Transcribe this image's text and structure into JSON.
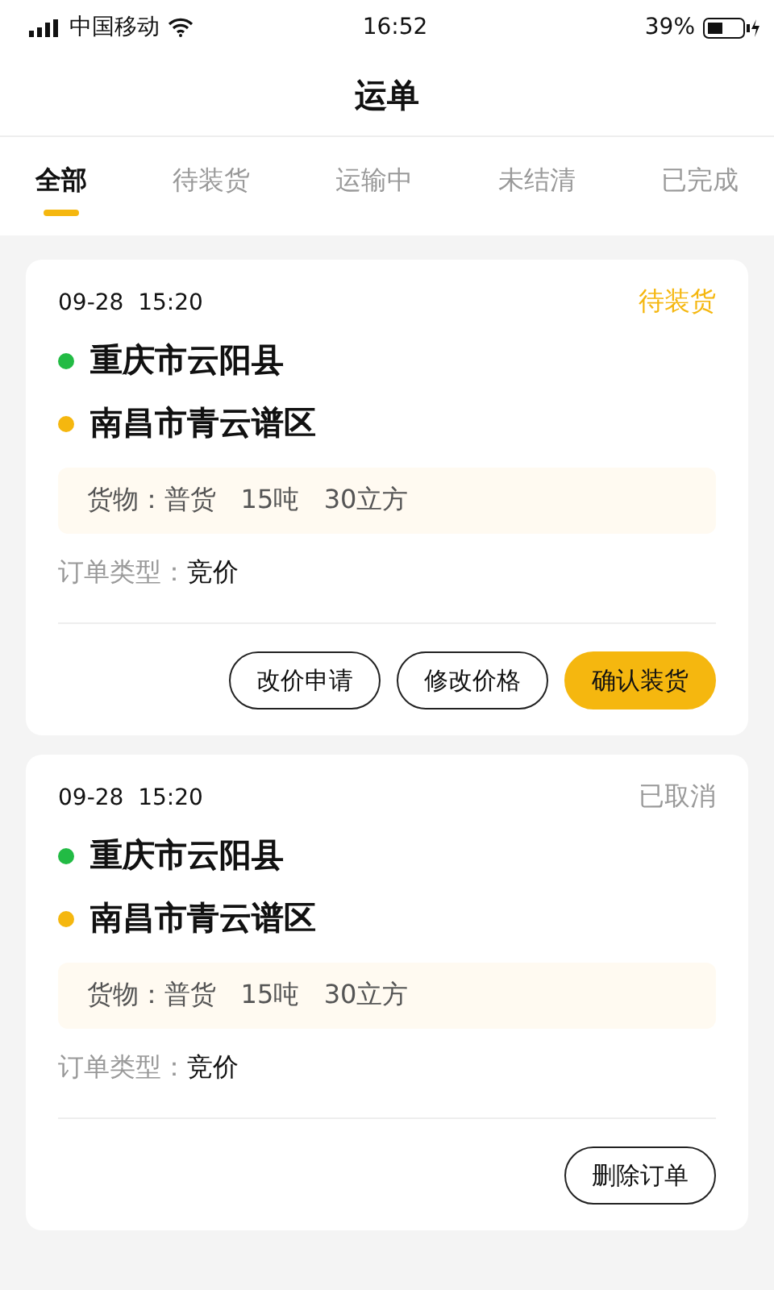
{
  "status_bar": {
    "carrier": "中国移动",
    "time": "16:52",
    "battery": "39%"
  },
  "header": {
    "title": "运单"
  },
  "tabs": [
    {
      "label": "全部",
      "selected": true
    },
    {
      "label": "待装货",
      "selected": false
    },
    {
      "label": "运输中",
      "selected": false
    },
    {
      "label": "未结清",
      "selected": false
    },
    {
      "label": "已完成",
      "selected": false
    }
  ],
  "orders": [
    {
      "time": "09-28  15:20",
      "status": {
        "label": "待装货",
        "kind": "pending"
      },
      "stops": [
        {
          "place": "重庆市云阳县",
          "color": "#22bb44"
        },
        {
          "place": "南昌市青云谱区",
          "color": "#f5b70f"
        }
      ],
      "cargo": "货物：普货   15吨   30立方",
      "type_label": "订单类型：",
      "type_value": "竞价",
      "buttons": [
        {
          "label": "改价申请",
          "kind": "outline"
        },
        {
          "label": "修改价格",
          "kind": "outline"
        },
        {
          "label": "确认装货",
          "kind": "primary"
        }
      ]
    },
    {
      "time": "09-28  15:20",
      "status": {
        "label": "已取消",
        "kind": "cancelled"
      },
      "stops": [
        {
          "place": "重庆市云阳县",
          "color": "#22bb44"
        },
        {
          "place": "南昌市青云谱区",
          "color": "#f5b70f"
        }
      ],
      "cargo": "货物：普货   15吨   30立方",
      "type_label": "订单类型：",
      "type_value": "竞价",
      "buttons": [
        {
          "label": "删除订单",
          "kind": "outline"
        }
      ]
    }
  ]
}
